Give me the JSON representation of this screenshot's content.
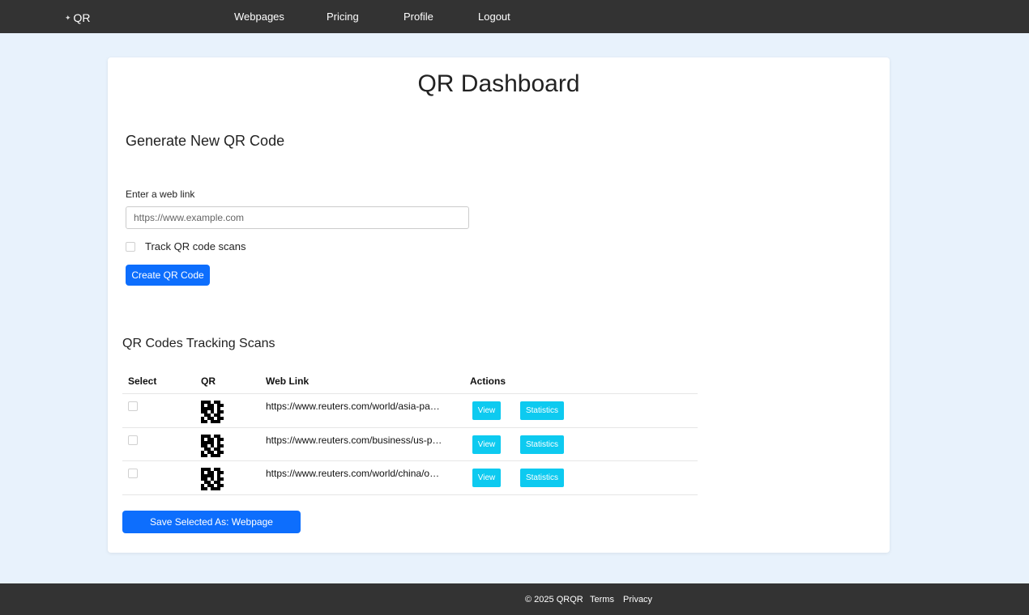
{
  "nav": {
    "brand_text": "QR",
    "brand_icon": "sparkle-icon",
    "links": [
      "Webpages",
      "Pricing",
      "Profile",
      "Logout"
    ]
  },
  "main": {
    "title": "QR Dashboard",
    "generate": {
      "heading": "Generate New QR Code",
      "field_label": "Enter a web link",
      "placeholder": "https://www.example.com",
      "value": "",
      "track_label": "Track QR code scans",
      "track_checked": false,
      "create_label": "Create QR Code"
    },
    "tracking": {
      "heading": "QR Codes Tracking Scans",
      "columns": [
        "Select",
        "QR",
        "Web Link",
        "Actions"
      ],
      "rows": [
        {
          "selected": false,
          "link": "https://www.reuters.com/world/asia-pac…",
          "view_label": "View",
          "stats_label": "Statistics"
        },
        {
          "selected": false,
          "link": "https://www.reuters.com/business/us-pr…",
          "view_label": "View",
          "stats_label": "Statistics"
        },
        {
          "selected": false,
          "link": "https://www.reuters.com/world/china/oe…",
          "view_label": "View",
          "stats_label": "Statistics"
        }
      ],
      "save_label": "Save Selected As: Webpage"
    }
  },
  "footer": {
    "copyright": "© 2025 QRQR",
    "links": [
      "Terms",
      "Privacy"
    ]
  },
  "colors": {
    "navbar": "#333333",
    "background": "#e8f2fc",
    "primary": "#0d6efd",
    "info": "#0dcaf0"
  }
}
